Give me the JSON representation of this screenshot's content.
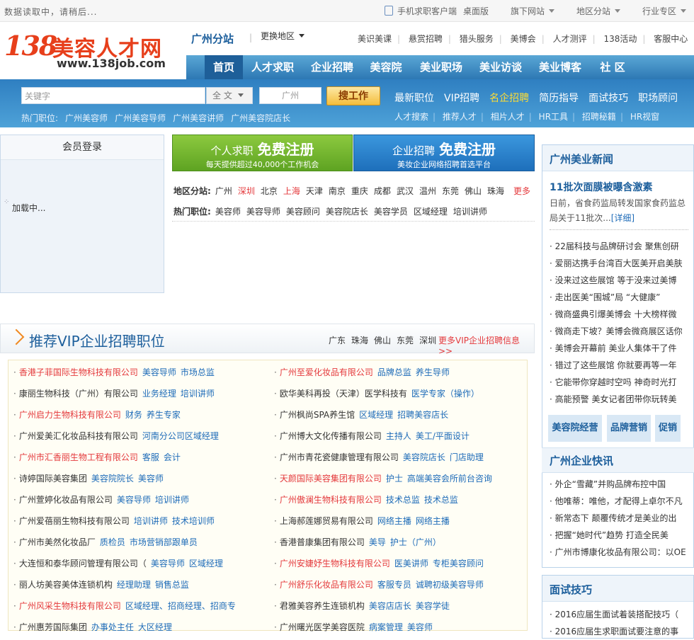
{
  "topbar": {
    "loading": "数据读取中，请稍后...",
    "links": [
      "手机求职客户端",
      "桌面版",
      "旗下网站",
      "地区分站",
      "行业专区"
    ]
  },
  "logo": {
    "num": "138",
    "brand": "美容人才网",
    "url": "www.138job.com"
  },
  "header": {
    "branch": "广州分站",
    "change_area": "更换地区",
    "subnav": [
      "美识美课",
      "悬赏招聘",
      "猎头服务",
      "美博会",
      "人才测评",
      "138活动",
      "客服中心"
    ]
  },
  "mainnav": [
    "首页",
    "人才求职",
    "企业招聘",
    "美容院",
    "美业职场",
    "美业访谈",
    "美业博客",
    "社 区"
  ],
  "search": {
    "keyword_placeholder": "关键字",
    "scope": "全 文",
    "city_placeholder": "广州",
    "button": "搜工作",
    "hot_label": "热门职位:",
    "hot_jobs": [
      "广州美容师",
      "广州美容导师",
      "广州美容讲师",
      "广州美容院店长"
    ],
    "nav1": [
      "最新职位",
      "VIP招聘",
      "名企招聘",
      "简历指导",
      "面试技巧",
      "职场顾问"
    ],
    "nav2": [
      "人才搜索",
      "推荐人才",
      "相片人才",
      "HR工具",
      "招聘秘籍",
      "HR视窗"
    ]
  },
  "login": {
    "title": "会员登录",
    "loading": "加载中..."
  },
  "register": {
    "personal": {
      "prefix": "个人求职",
      "main": "免费注册",
      "sub": "每天提供超过40,000个工作机会"
    },
    "company": {
      "prefix": "企业招聘",
      "main": "免费注册",
      "sub": "美妆企业网络招聘首选平台"
    }
  },
  "areas": {
    "label": "地区分站:",
    "cities": [
      "广州",
      "深圳",
      "北京",
      "上海",
      "天津",
      "南京",
      "重庆",
      "成都",
      "武汉",
      "温州",
      "东莞",
      "佛山",
      "珠海"
    ],
    "highlight": [
      "深圳",
      "上海"
    ],
    "more": "更多"
  },
  "hot_positions": {
    "label": "热门职位:",
    "items": [
      "美容师",
      "美容导师",
      "美容顾问",
      "美容院店长",
      "美容学员",
      "区域经理",
      "培训讲师"
    ]
  },
  "vip": {
    "title": "推荐VIP企业招聘职位",
    "cities": [
      "广东",
      "珠海",
      "佛山",
      "东莞",
      "深圳"
    ],
    "more": "更多VIP企业招聘信息>>",
    "rows": [
      {
        "co": "香港子菲国际生物科技有限公司",
        "red": true,
        "jobs": [
          "美容导师",
          "市场总监"
        ]
      },
      {
        "co": "广州至爱化妆品有限公司",
        "red": true,
        "jobs": [
          "品牌总监",
          "养生导师"
        ]
      },
      {
        "co": "康丽生物科技（广州）有限公司",
        "red": false,
        "jobs": [
          "业务经理",
          "培训讲师"
        ]
      },
      {
        "co": "欧华美科再投（天津）医学科技有",
        "red": false,
        "jobs": [
          "医学专家（操作）"
        ]
      },
      {
        "co": "广州启力生物科技有限公司",
        "red": true,
        "jobs": [
          "财务",
          "养生专家"
        ]
      },
      {
        "co": "广州枫尚SPA养生馆",
        "red": false,
        "jobs": [
          "区域经理",
          "招聘美容店长"
        ]
      },
      {
        "co": "广州爱美汇化妆品科技有限公司",
        "red": false,
        "jobs": [
          "河南分公司区域经理"
        ]
      },
      {
        "co": "广州博大文化传播有限公司",
        "red": false,
        "jobs": [
          "主持人",
          "美工/平面设计"
        ]
      },
      {
        "co": "广州市汇香丽生物工程有限公司",
        "red": true,
        "jobs": [
          "客服",
          "会计"
        ]
      },
      {
        "co": "广州市青花瓷健康管理有限公司",
        "red": false,
        "jobs": [
          "美容院店长",
          "门店助理"
        ]
      },
      {
        "co": "诗婷国际美容集团",
        "red": false,
        "jobs": [
          "美容院院长",
          "美容师"
        ]
      },
      {
        "co": "天颜国际美容集团有限公司",
        "red": true,
        "jobs": [
          "护士",
          "高端美容会所前台咨询"
        ]
      },
      {
        "co": "广州萱婷化妆品有限公司",
        "red": false,
        "jobs": [
          "美容导师",
          "培训讲师"
        ]
      },
      {
        "co": "广州傲澜生物科技有限公司",
        "red": true,
        "jobs": [
          "技术总监",
          "技术总监"
        ]
      },
      {
        "co": "广州爱蓓丽生物科技有限公司",
        "red": false,
        "jobs": [
          "培训讲师",
          "技术培训师"
        ]
      },
      {
        "co": "上海郝莲娜贸易有限公司",
        "red": false,
        "jobs": [
          "网络主播",
          "网络主播"
        ]
      },
      {
        "co": "广州市美然化妆品厂",
        "red": false,
        "jobs": [
          "质检员",
          "市场营销部跟单员"
        ]
      },
      {
        "co": "香港普康集团有限公司",
        "red": false,
        "jobs": [
          "美导",
          "护士（广州）"
        ]
      },
      {
        "co": "大连恒和泰华顾问管理有限公司（",
        "red": false,
        "jobs": [
          "美容导师",
          "区域经理"
        ]
      },
      {
        "co": "广州安婕妤生物科技有限公司",
        "red": true,
        "jobs": [
          "医美讲师",
          "专柜美容顾问"
        ]
      },
      {
        "co": "丽人坊美容美体连锁机构",
        "red": false,
        "jobs": [
          "经理助理",
          "销售总监"
        ]
      },
      {
        "co": "广州舒乐化妆品有限公司",
        "red": true,
        "jobs": [
          "客服专员",
          "诚聘初级美容导师"
        ]
      },
      {
        "co": "广州风采生物科技有限公司",
        "red": true,
        "jobs": [
          "区域经理、招商经理、招商专"
        ]
      },
      {
        "co": "君雅美容养生连锁机构",
        "red": false,
        "jobs": [
          "美容店店长",
          "美容学徒"
        ]
      },
      {
        "co": "广州惠芳国际集团",
        "red": false,
        "jobs": [
          "办事处主任",
          "大区经理"
        ]
      },
      {
        "co": "广州曙光医学美容医院",
        "red": false,
        "jobs": [
          "病案管理",
          "美容师"
        ]
      }
    ]
  },
  "news": {
    "title": "广州美业新闻",
    "head": "11批次面膜被曝含激素",
    "summary": "日前，省食药监局转发国家食药监总局关于11批次...",
    "detail": "[详细]",
    "items": [
      "22届科技与品牌研讨会 聚焦创研",
      "爱丽达携手台湾百大医美开启美肤",
      "没来过这些展馆 等于没来过美博",
      "走出医美“围城”局 “大健康”",
      "微商盛典引爆美博会 十大榜样微",
      "微商走下坡？美博会微商展区话你",
      "美博会开幕前 美业人集体干了件",
      "错过了这些展馆 你就要再等一年",
      "它能带你穿越时空吗 神奇时光打",
      "高能预警 美女记者团带你玩转美"
    ],
    "tags": [
      "美容院经营",
      "品牌营销",
      "促销"
    ]
  },
  "quicknews": {
    "title": "广州企业快讯",
    "items": [
      "外企“雪藏”并购品牌布控中国",
      "他唯蒂：唯他，才配得上卓尔不凡",
      "新常态下 颠覆传统才是美业的出",
      "把握“她时代”趋势 打造全民美",
      "广州市博康化妆品有限公司：以OE"
    ]
  },
  "interview": {
    "title": "面试技巧",
    "items": [
      "2016应届生面试着装搭配技巧（",
      "2016应届生求职面试要注意的事"
    ]
  }
}
